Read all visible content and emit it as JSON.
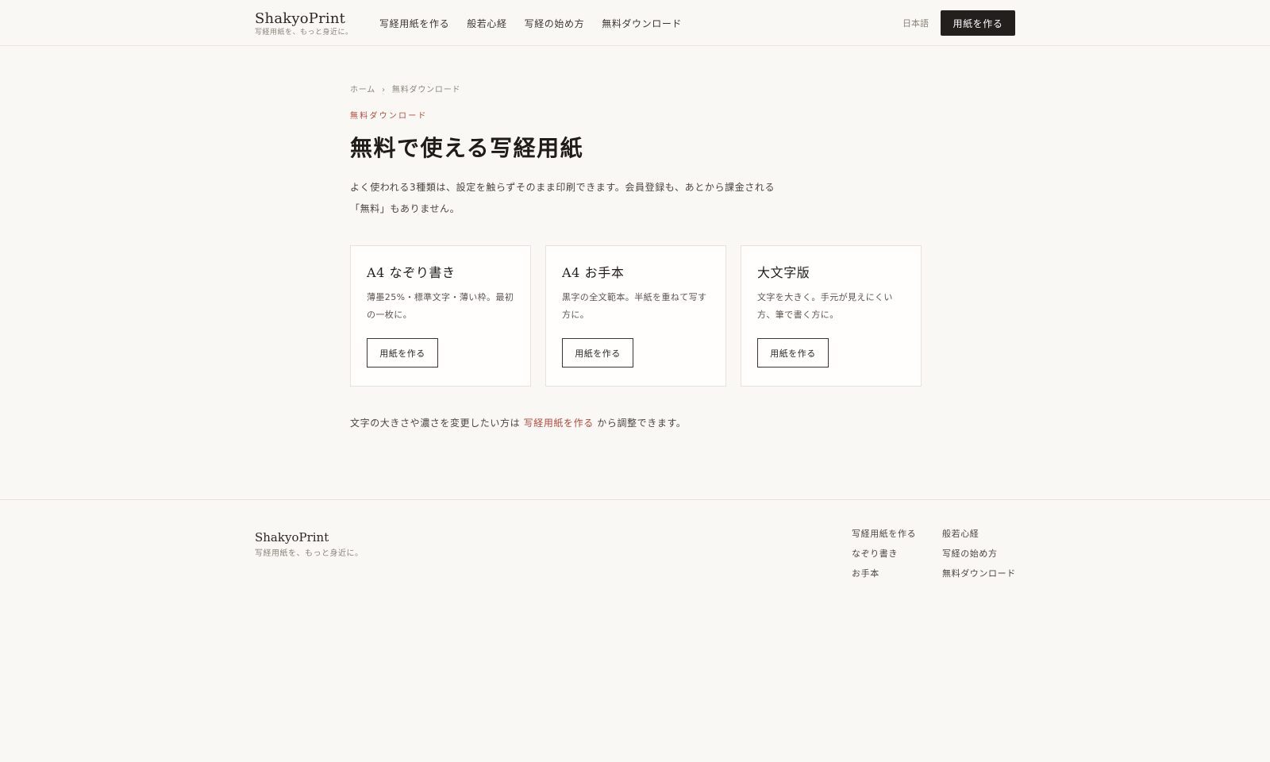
{
  "header": {
    "brand_name": "ShakyoPrint",
    "brand_tagline": "写経用紙を、もっと身近に。",
    "nav": [
      "写経用紙を作る",
      "般若心経",
      "写経の始め方",
      "無料ダウンロード"
    ],
    "language": "日本語",
    "cta_label": "用紙を作る"
  },
  "breadcrumb": {
    "home": "ホーム",
    "separator": "›",
    "current": "無料ダウンロード"
  },
  "page": {
    "eyebrow": "無料ダウンロード",
    "title": "無料で使える写経用紙",
    "lead": "よく使われる3種類は、設定を触らずそのまま印刷できます。会員登録も、あとから課金される「無料」もありません。"
  },
  "cards": [
    {
      "title": "A4 なぞり書き",
      "description": "薄墨25%・標準文字・薄い枠。最初の一枚に。",
      "button": "用紙を作る"
    },
    {
      "title": "A4 お手本",
      "description": "黒字の全文範本。半紙を重ねて写す方に。",
      "button": "用紙を作る"
    },
    {
      "title": "大文字版",
      "description": "文字を大きく。手元が見えにくい方、筆で書く方に。",
      "button": "用紙を作る"
    }
  ],
  "note": {
    "before": "文字の大きさや濃さを変更したい方は",
    "link": "写経用紙を作る",
    "after": "から調整できます。"
  },
  "footer": {
    "brand_name": "ShakyoPrint",
    "brand_tagline": "写経用紙を、もっと身近に。",
    "col1": [
      "写経用紙を作る",
      "なぞり書き",
      "お手本"
    ],
    "col2": [
      "般若心経",
      "写経の始め方",
      "無料ダウンロード"
    ]
  },
  "colors": {
    "background": "#faf8f4",
    "accent": "#b24a3c",
    "primary_button": "#221f1d"
  }
}
